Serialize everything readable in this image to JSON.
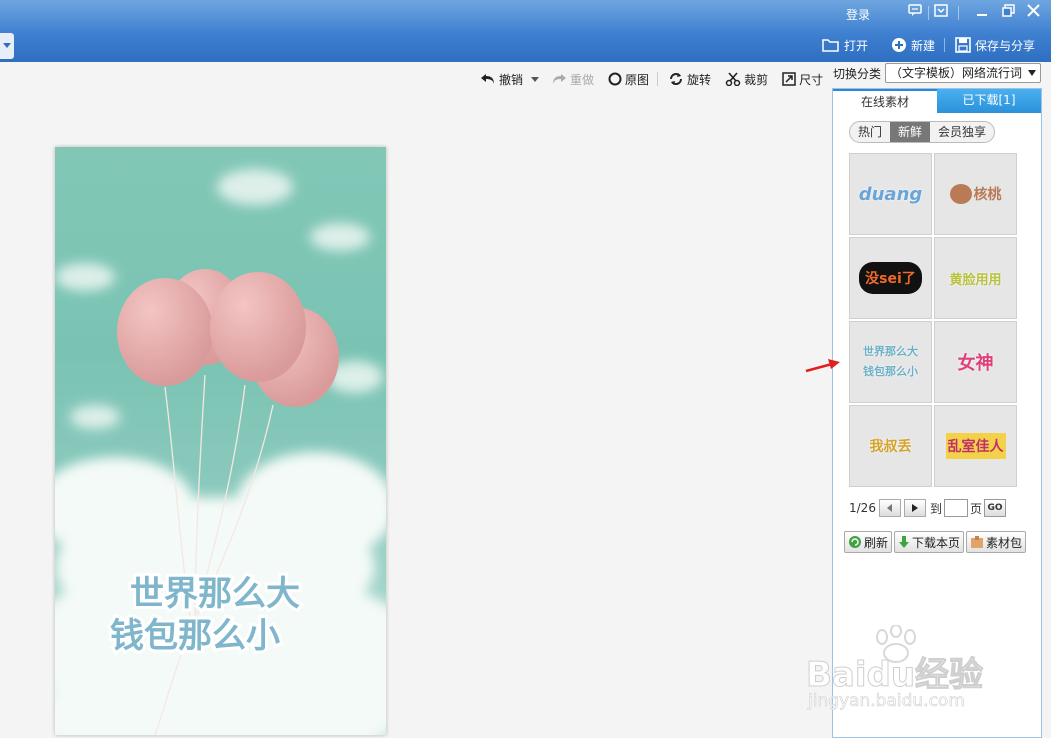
{
  "titlebar": {
    "login": "登录",
    "actions": {
      "open": "打开",
      "new": "新建",
      "save_share": "保存与分享"
    }
  },
  "edit_toolbar": {
    "undo": "撤销",
    "redo": "重做",
    "original": "原图",
    "rotate": "旋转",
    "crop": "裁剪",
    "size": "尺寸"
  },
  "canvas": {
    "overlay_line1": "世界那么大",
    "overlay_line2": "钱包那么小"
  },
  "right_panel": {
    "category_label": "切换分类",
    "category_value": "（文字模板）网络流行词",
    "tabs": [
      "在线素材",
      "已下载[1]"
    ],
    "sub_tabs": [
      "热门",
      "新鲜",
      "会员独享"
    ],
    "active_sub_tab": "新鲜",
    "stickers": [
      "duang",
      "核桃",
      "没sei了",
      "黄脸用用",
      "世界那么大 钱包那么小",
      "女神",
      "我叔丢",
      "乱室佳人"
    ],
    "pager": {
      "current": "1/26",
      "to_label": "到",
      "page_label": "页",
      "go": "GO"
    },
    "actions": {
      "refresh": "刷新",
      "download_page": "下载本页",
      "material_pack": "素材包"
    }
  },
  "watermark": {
    "brand": "Baidu经验",
    "url": "jingyan.baidu.com"
  },
  "colors": {
    "titlebar": "#3e7fd0",
    "tab_active_border": "#2d86d6",
    "tab_inactive": "#2a91dc",
    "photo_sky": "#82c7b6",
    "balloon": "#e8a6a6",
    "arrow": "#e02020"
  }
}
